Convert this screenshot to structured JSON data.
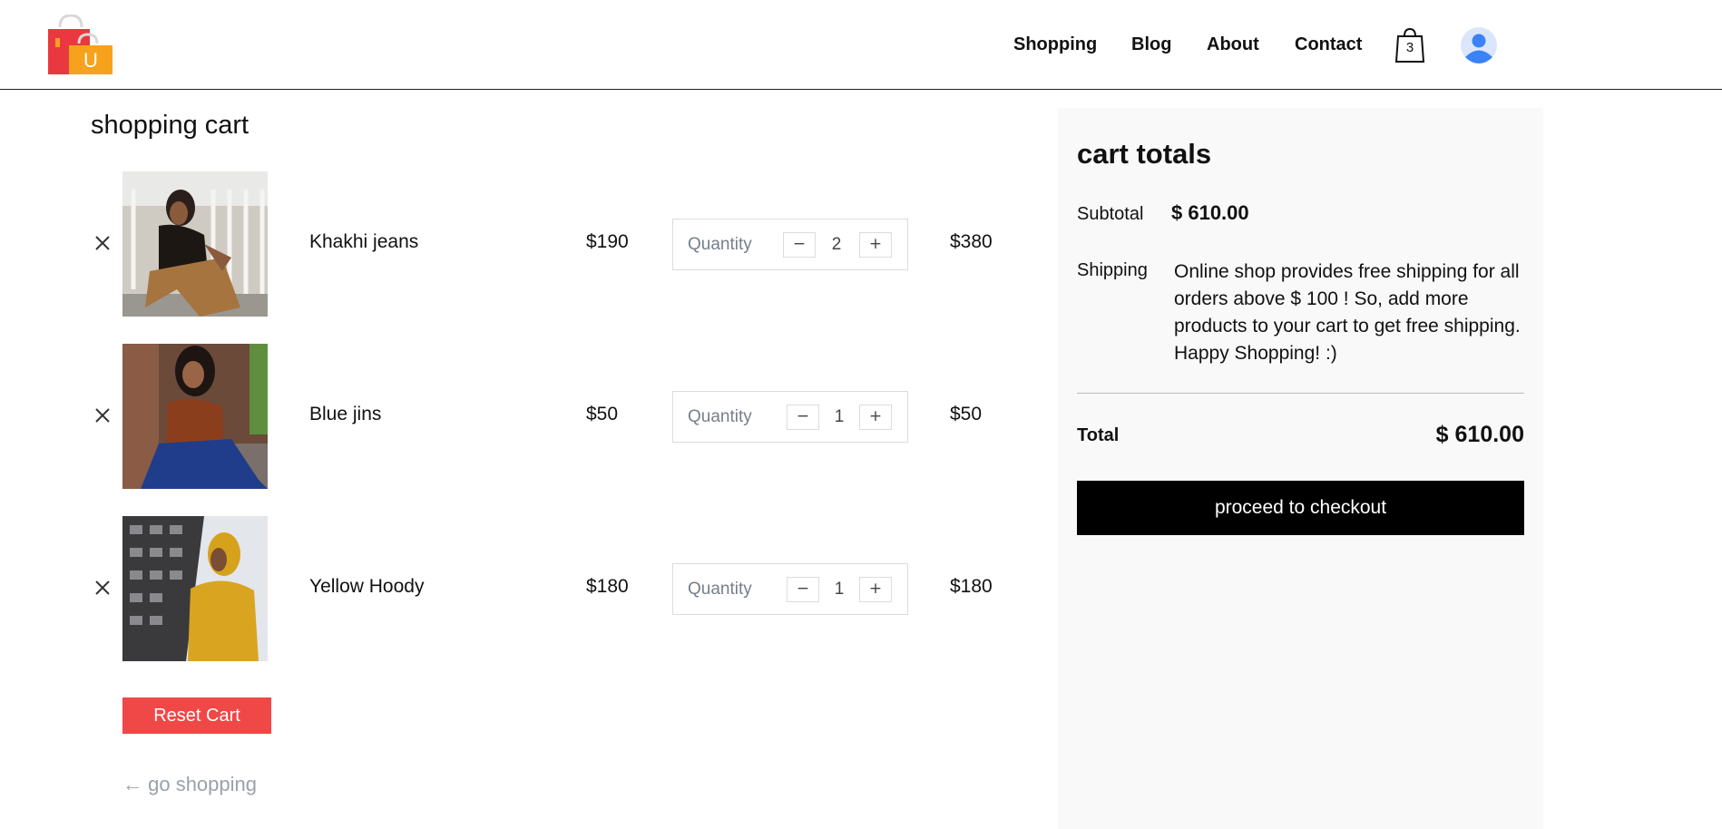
{
  "header": {
    "logo_letter": "U",
    "nav": [
      "Shopping",
      "Blog",
      "About",
      "Contact"
    ],
    "cart_count": "3"
  },
  "cart": {
    "title": "shopping cart",
    "quantity_label": "Quantity",
    "items": [
      {
        "name": "Khakhi jeans",
        "price": "$190",
        "quantity": "2",
        "total": "$380"
      },
      {
        "name": "Blue jins",
        "price": "$50",
        "quantity": "1",
        "total": "$50"
      },
      {
        "name": "Yellow Hoody",
        "price": "$180",
        "quantity": "1",
        "total": "$180"
      }
    ],
    "decrement_symbol": "−",
    "increment_symbol": "+",
    "reset_label": "Reset Cart",
    "go_shopping_label": "← go shopping"
  },
  "totals": {
    "title": "cart totals",
    "subtotal_label": "Subtotal",
    "subtotal_value": "$ 610.00",
    "shipping_label": "Shipping",
    "shipping_text": "Online shop provides free shipping for all orders above $ 100 ! So, add more products to your cart to get free shipping. Happy Shopping! :)",
    "total_label": "Total",
    "total_value": "$ 610.00",
    "checkout_label": "proceed to checkout"
  },
  "colors": {
    "reset_button": "#f04747",
    "checkout_button": "#000000",
    "totals_panel_bg": "#f9f9f9",
    "muted_text": "#9aa1ab"
  }
}
